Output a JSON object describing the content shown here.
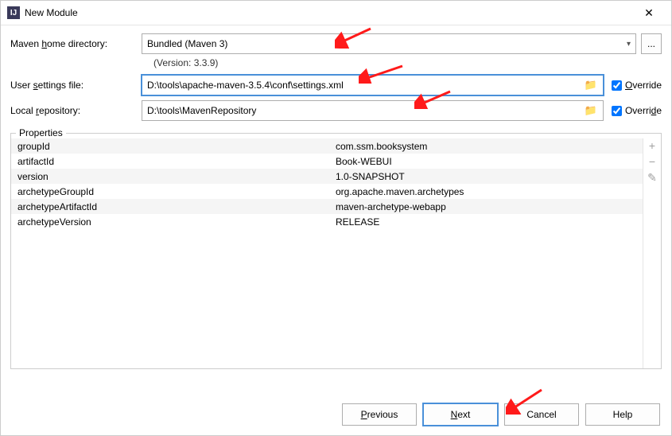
{
  "window": {
    "title": "New Module"
  },
  "maven": {
    "label_home": "Maven home directory:",
    "home_value": "Bundled (Maven 3)",
    "version_text": "(Version: 3.3.9)",
    "label_settings": "User settings file:",
    "settings_value": "D:\\tools\\apache-maven-3.5.4\\conf\\settings.xml",
    "label_repo": "Local repository:",
    "repo_value": "D:\\tools\\MavenRepository",
    "override_label": "Override"
  },
  "properties": {
    "legend": "Properties",
    "rows": [
      {
        "k": "groupId",
        "v": "com.ssm.booksystem"
      },
      {
        "k": "artifactId",
        "v": "Book-WEBUI"
      },
      {
        "k": "version",
        "v": "1.0-SNAPSHOT"
      },
      {
        "k": "archetypeGroupId",
        "v": "org.apache.maven.archetypes"
      },
      {
        "k": "archetypeArtifactId",
        "v": "maven-archetype-webapp"
      },
      {
        "k": "archetypeVersion",
        "v": "RELEASE"
      }
    ],
    "icons": {
      "add": "+",
      "remove": "−",
      "edit": "✎"
    }
  },
  "buttons": {
    "previous": "Previous",
    "next": "Next",
    "cancel": "Cancel",
    "help": "Help"
  },
  "browse_btn": "..."
}
